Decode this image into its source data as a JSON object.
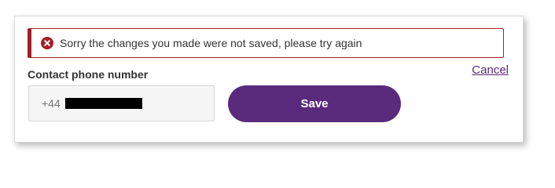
{
  "error_banner": {
    "message": "Sorry the changes you made were not saved, please try again",
    "icon": "error-x-circle-icon",
    "color": "#a31f27"
  },
  "cancel_link": {
    "label": "Cancel"
  },
  "phone_field": {
    "label": "Contact phone number",
    "prefix": "+44"
  },
  "save_button": {
    "label": "Save",
    "color": "#5a2a7c"
  }
}
